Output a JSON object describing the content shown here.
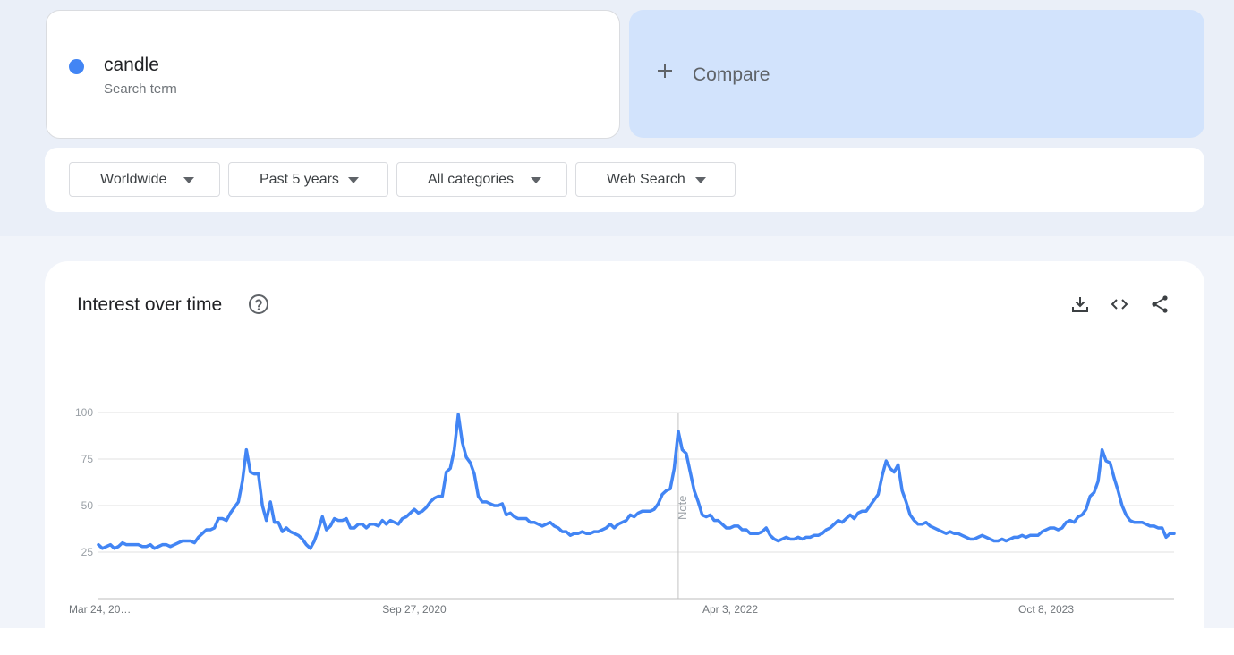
{
  "search_term": {
    "name": "candle",
    "subtitle": "Search term",
    "color": "#4285f4"
  },
  "compare": {
    "label": "Compare"
  },
  "filters": {
    "region": "Worldwide",
    "time": "Past 5 years",
    "category": "All categories",
    "property": "Web Search"
  },
  "chart_panel": {
    "title": "Interest over time",
    "note_label": "Note"
  },
  "icons": {
    "help": "help-circle-icon",
    "download": "download-icon",
    "embed": "code-icon",
    "share": "share-icon",
    "add": "plus-icon",
    "dropdown": "caret-down-icon"
  },
  "chart_data": {
    "type": "line",
    "title": "Interest over time",
    "xlabel": "",
    "ylabel": "",
    "ylim": [
      0,
      100
    ],
    "yticks": [
      25,
      50,
      75,
      100
    ],
    "x_start": "2019-03-24",
    "x_step_days": 7,
    "x_tick_labels": [
      {
        "date": "2019-03-24",
        "label": "Mar 24, 20…"
      },
      {
        "date": "2020-09-27",
        "label": "Sep 27, 2020"
      },
      {
        "date": "2022-04-03",
        "label": "Apr 3, 2022"
      },
      {
        "date": "2023-10-08",
        "label": "Oct 8, 2023"
      }
    ],
    "note_date": "2022-01-02",
    "grid": true,
    "color": "#4285f4",
    "series": [
      {
        "values": [
          29,
          27,
          28,
          29,
          27,
          28,
          30,
          29,
          29,
          29,
          29,
          28,
          28,
          29,
          27,
          28,
          29,
          29,
          28,
          29,
          30,
          31,
          31,
          31,
          30,
          33,
          35,
          37,
          37,
          38,
          43,
          43,
          42,
          46,
          49,
          52,
          63,
          80,
          68,
          67,
          67,
          50,
          42,
          52,
          41,
          41,
          36,
          38,
          36,
          35,
          34,
          32,
          29,
          27,
          31,
          37,
          44,
          37,
          39,
          43,
          42,
          42,
          43,
          38,
          38,
          40,
          40,
          38,
          40,
          40,
          39,
          42,
          40,
          42,
          41,
          40,
          43,
          44,
          46,
          48,
          46,
          47,
          49,
          52,
          54,
          55,
          55,
          68,
          70,
          80,
          99,
          84,
          76,
          73,
          67,
          55,
          52,
          52,
          51,
          50,
          50,
          51,
          45,
          46,
          44,
          43,
          43,
          43,
          41,
          41,
          40,
          39,
          40,
          41,
          39,
          38,
          36,
          36,
          34,
          35,
          35,
          36,
          35,
          35,
          36,
          36,
          37,
          38,
          40,
          38,
          40,
          41,
          42,
          45,
          44,
          46,
          47,
          47,
          47,
          48,
          51,
          56,
          58,
          59,
          70,
          90,
          80,
          78,
          68,
          58,
          52,
          45,
          44,
          45,
          42,
          42,
          40,
          38,
          38,
          39,
          39,
          37,
          37,
          35,
          35,
          35,
          36,
          38,
          34,
          32,
          31,
          32,
          33,
          32,
          32,
          33,
          32,
          33,
          33,
          34,
          34,
          35,
          37,
          38,
          40,
          42,
          41,
          43,
          45,
          43,
          46,
          47,
          47,
          50,
          53,
          56,
          66,
          74,
          70,
          68,
          72,
          58,
          52,
          45,
          42,
          40,
          40,
          41,
          39,
          38,
          37,
          36,
          35,
          36,
          35,
          35,
          34,
          33,
          32,
          32,
          33,
          34,
          33,
          32,
          31,
          31,
          32,
          31,
          32,
          33,
          33,
          34,
          33,
          34,
          34,
          34,
          36,
          37,
          38,
          38,
          37,
          38,
          41,
          42,
          41,
          44,
          45,
          48,
          55,
          57,
          63,
          80,
          74,
          73,
          65,
          58,
          50,
          45,
          42,
          41,
          41,
          41,
          40,
          39,
          39,
          38,
          38,
          33,
          35,
          35
        ]
      }
    ]
  }
}
